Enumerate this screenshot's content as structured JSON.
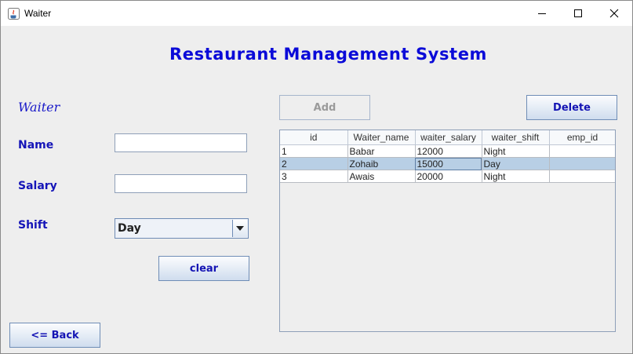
{
  "window": {
    "title": "Waiter"
  },
  "header": {
    "title": "Restaurant Management System"
  },
  "form": {
    "section_title": "Waiter",
    "name_label": "Name",
    "name_value": "",
    "salary_label": "Salary",
    "salary_value": "",
    "shift_label": "Shift",
    "shift_value": "Day",
    "clear_label": "clear"
  },
  "actions": {
    "add_label": "Add",
    "delete_label": "Delete",
    "back_label": "<= Back"
  },
  "table": {
    "columns": [
      "id",
      "Waiter_name",
      "waiter_salary",
      "waiter_shift",
      "emp_id"
    ],
    "rows": [
      [
        "1",
        "Babar",
        "12000",
        "Night",
        ""
      ],
      [
        "2",
        "Zohaib",
        "15000",
        "Day",
        ""
      ],
      [
        "3",
        "Awais",
        "20000",
        "Night",
        ""
      ]
    ],
    "selected_row_index": 1
  },
  "colors": {
    "accent": "#0a0ad8",
    "label": "#1515b8",
    "selection": "#b8cfe5"
  }
}
